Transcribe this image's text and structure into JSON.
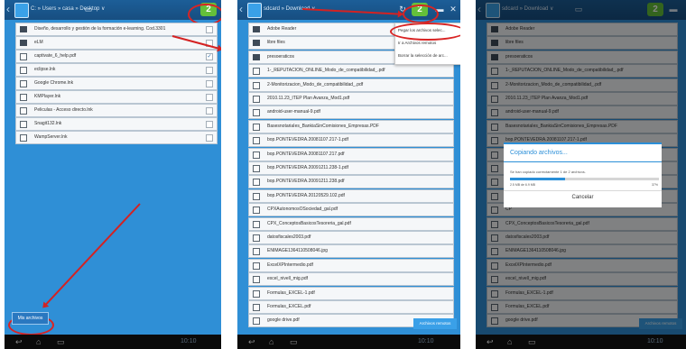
{
  "panel1": {
    "path": "C: » Users » casa » Desktop ∨",
    "badge": "2",
    "items": [
      {
        "label": "Diseño, desarrollo y gestión de la formación e-learning. Cod.3301",
        "type": "folder",
        "checked": false
      },
      {
        "label": "eLM",
        "type": "folder",
        "checked": false
      },
      {
        "label": "captivate_6_help.pdf",
        "type": "file",
        "checked": true
      },
      {
        "label": "eclipse.lnk",
        "type": "file",
        "checked": false
      },
      {
        "label": "Google Chrome.lnk",
        "type": "file",
        "checked": false
      },
      {
        "label": "KMPlayer.lnk",
        "type": "file",
        "checked": false
      },
      {
        "label": "Peliculas - Acceso directo.lnk",
        "type": "file",
        "checked": false
      },
      {
        "label": "Snagit132.lnk",
        "type": "file",
        "checked": false
      },
      {
        "label": "WampServer.lnk",
        "type": "file",
        "checked": false
      }
    ],
    "my_files_button": "Mis archivos"
  },
  "panel2": {
    "path": "sdcard » Download ∨",
    "badge": "2",
    "menu": {
      "items": [
        "Pegar los archivos selec...",
        "Ir a Archivos remotos",
        "Borrar la selección de arc..."
      ]
    },
    "items": [
      {
        "label": "Adobe Reader",
        "type": "folder"
      },
      {
        "label": "libre files",
        "type": "folder"
      },
      {
        "label": "presoeraticos",
        "type": "folder"
      },
      {
        "label": "1-_REPUTACION_ONLINE_Modo_de_compatibilidad_.pdf",
        "type": "file"
      },
      {
        "label": "2-Monitorizacion_Modo_de_compatibilidad_.pdf",
        "type": "file"
      },
      {
        "label": "2010.11.23_ITEP Plan Avanza_Mod1.pdf",
        "type": "file"
      },
      {
        "label": "android-user-manual-9.pdf",
        "type": "file"
      },
      {
        "label": "BasesnotariaIes_BankiaSinComisiones_Empresas.PDF",
        "type": "file"
      },
      {
        "label": "bop.PONTEVEDRA.20081107.217-1.pdf",
        "type": "file"
      },
      {
        "label": "bop.PONTEVEDRA.20081107.217.pdf",
        "type": "file"
      },
      {
        "label": "bop.PONTEVEDRA.20091211.238-1.pdf",
        "type": "file"
      },
      {
        "label": "bop.PONTEVEDRA.20091211.238.pdf",
        "type": "file"
      },
      {
        "label": "bop.PONTEVEDRA.20120529.102.pdf",
        "type": "file"
      },
      {
        "label": "CPXAutonomosOSociedad_gal.pdf",
        "type": "file"
      },
      {
        "label": "CPX_ConceptosBasicosTesoreria_gal.pdf",
        "type": "file"
      },
      {
        "label": "datosfiscales2003.pdf",
        "type": "file"
      },
      {
        "label": "ENIMAGE1364110508046.jpg",
        "type": "file"
      },
      {
        "label": "ExcelXPIntermedio.pdf",
        "type": "file"
      },
      {
        "label": "excel_nivell_mig.pdf",
        "type": "file"
      },
      {
        "label": "Formulas_EXCEL-1.pdf",
        "type": "file"
      },
      {
        "label": "Formulas_EXCEL.pdf",
        "type": "file"
      },
      {
        "label": "google drive.pdf",
        "type": "file"
      }
    ],
    "remote_button": "Archivos remotos"
  },
  "panel3": {
    "path": "sdcard » Download ∨",
    "badge": "2",
    "items": [
      {
        "label": "Adobe Reader",
        "type": "folder"
      },
      {
        "label": "libre files",
        "type": "folder"
      },
      {
        "label": "presoeraticos",
        "type": "folder"
      },
      {
        "label": "1-_REPUTACION_ONLINE_Modo_de_compatibilidad_.pdf",
        "type": "file"
      },
      {
        "label": "2-Monitorizacion_Modo_de_compatibilidad_.pdf",
        "type": "file"
      },
      {
        "label": "2010.11.23_ITEP Plan Avanza_Mod1.pdf",
        "type": "file"
      },
      {
        "label": "android-user-manual-9.pdf",
        "type": "file"
      },
      {
        "label": "BasesnotariaIes_BankiaSinComisiones_Empresas.PDF",
        "type": "file"
      },
      {
        "label": "bop.PONTEVEDRA.20081107.217-1.pdf",
        "type": "file"
      },
      {
        "label": "bop",
        "type": "file"
      },
      {
        "label": "bop",
        "type": "file"
      },
      {
        "label": "bop",
        "type": "file"
      },
      {
        "label": "bop",
        "type": "file"
      },
      {
        "label": "CP",
        "type": "file"
      },
      {
        "label": "CPX_ConceptosBasicosTesoreria_gal.pdf",
        "type": "file"
      },
      {
        "label": "datosfiscales2003.pdf",
        "type": "file"
      },
      {
        "label": "ENIMAGE1364110508046.jpg",
        "type": "file"
      },
      {
        "label": "ExcelXPIntermedio.pdf",
        "type": "file"
      },
      {
        "label": "excel_nivell_mig.pdf",
        "type": "file"
      },
      {
        "label": "Formulas_EXCEL-1.pdf",
        "type": "file"
      },
      {
        "label": "Formulas_EXCEL.pdf",
        "type": "file"
      },
      {
        "label": "google drive.pdf",
        "type": "file"
      }
    ],
    "remote_button": "Archivos remotos",
    "dialog": {
      "title": "Copiando archivos...",
      "message": "Se han copiado correctamente 1 de 2 archivos.",
      "size": "2.5 MB de 6.9 MB",
      "percent": "37%",
      "progress": 0.37,
      "cancel": "Cancelar"
    }
  },
  "navbar": {
    "clock": "10:10"
  },
  "colors": {
    "background": "#2f8fd6",
    "topbar": "#174e80",
    "badge": "#64c03a",
    "annotation": "#d42222"
  }
}
